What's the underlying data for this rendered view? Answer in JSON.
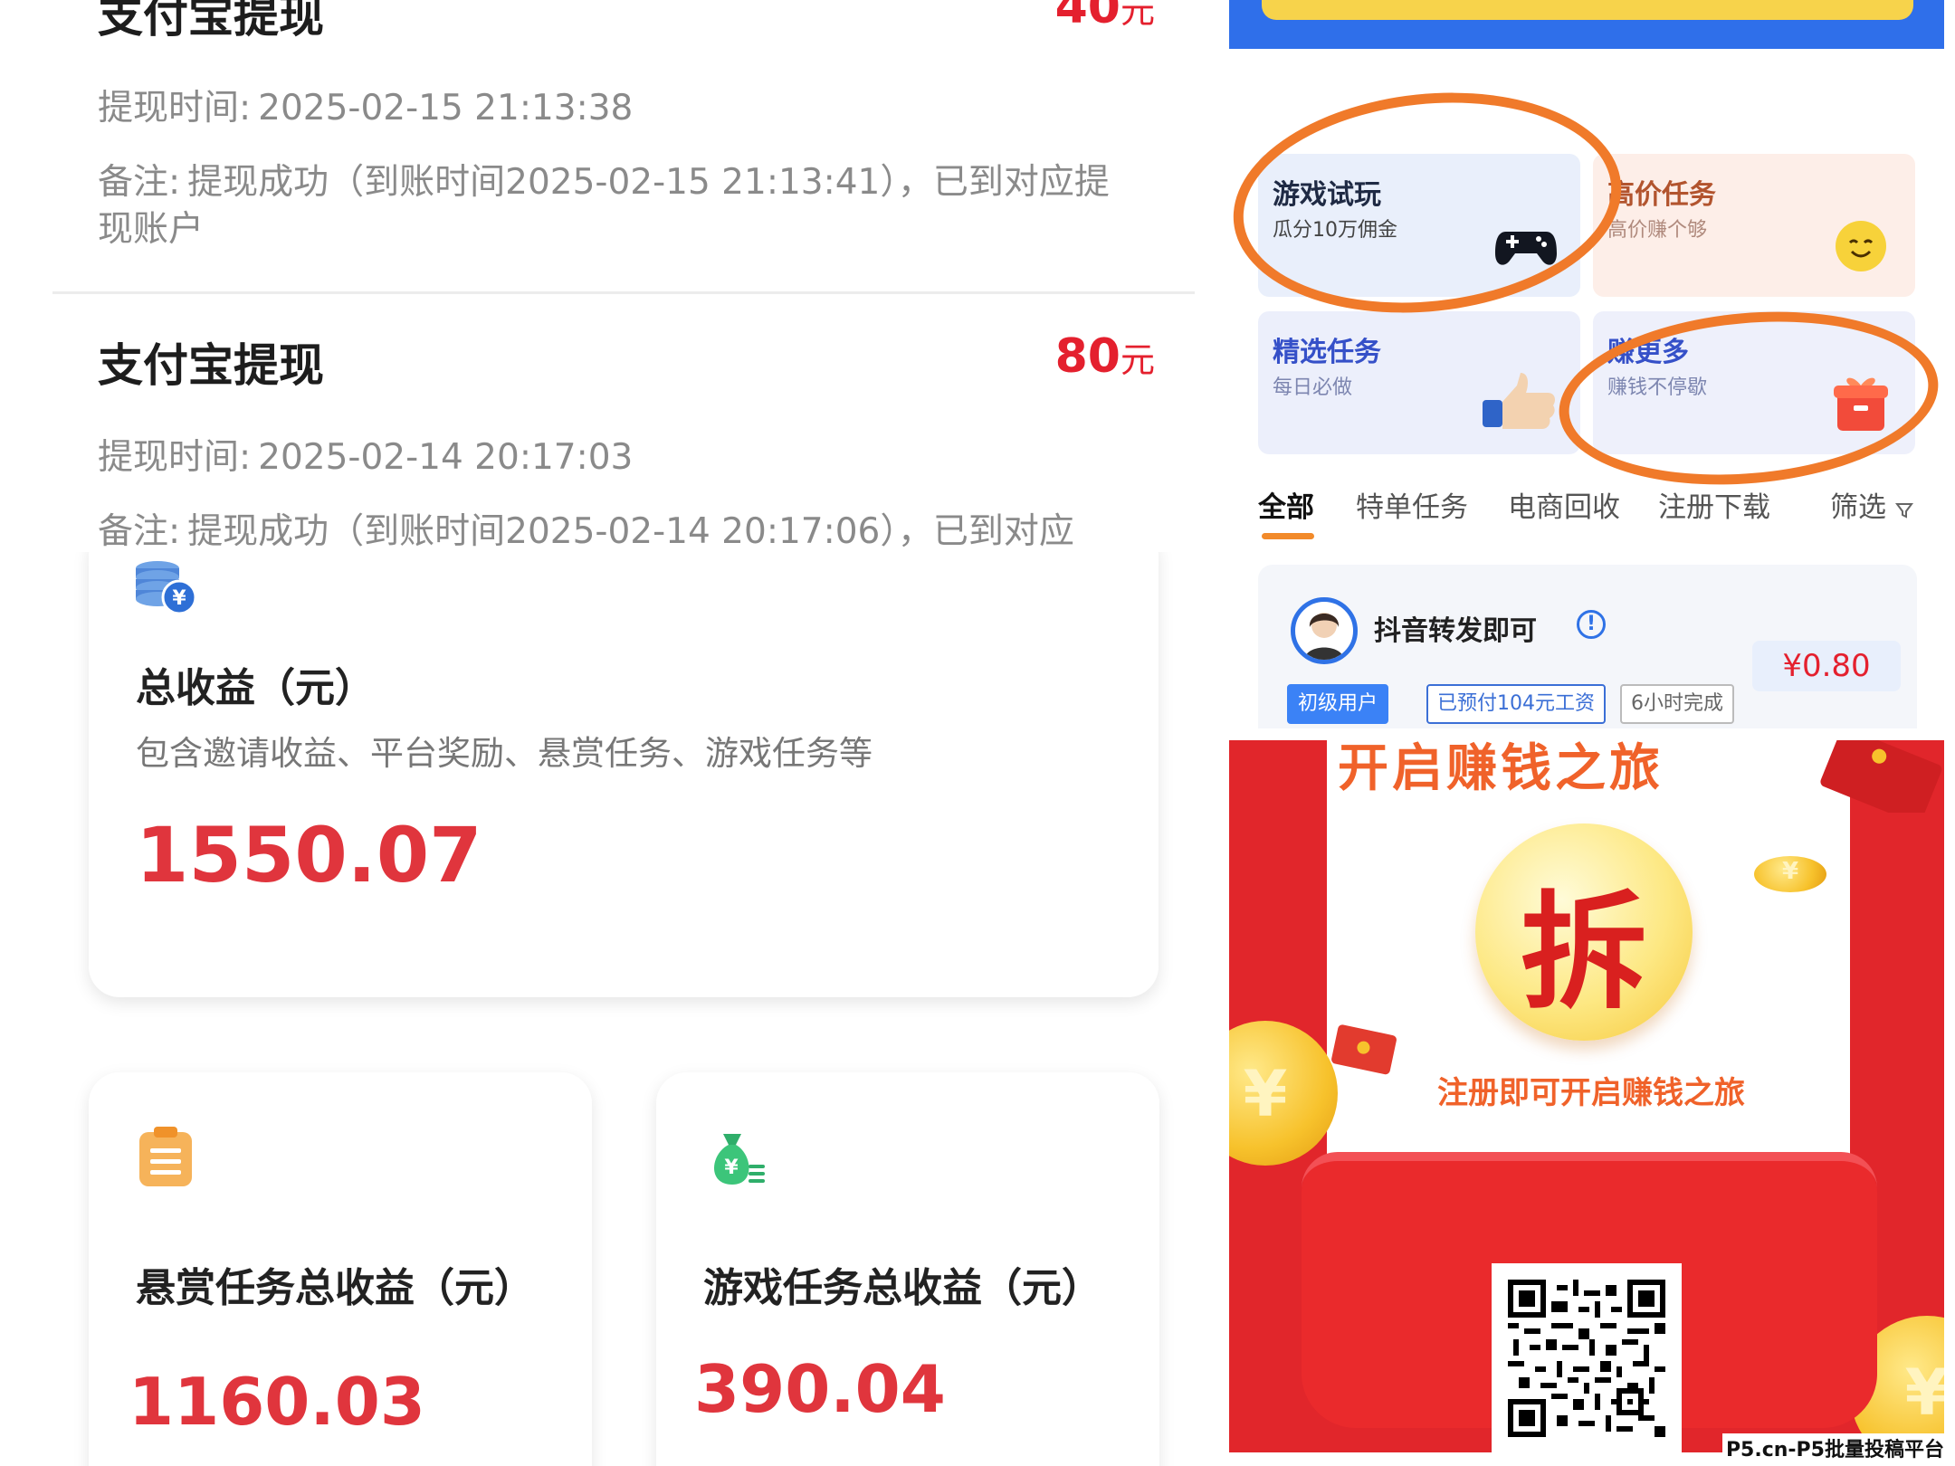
{
  "withdrawals": [
    {
      "title": "支付宝提现",
      "amount": "40",
      "unit": "元",
      "time_label": "提现时间:",
      "time": "2025-02-15 21:13:38",
      "note_label": "备注:",
      "note": "提现成功（到账时间2025-02-15 21:13:41），已到对应提现账户"
    },
    {
      "title": "支付宝提现",
      "amount": "80",
      "unit": "元",
      "time_label": "提现时间:",
      "time": "2025-02-14 20:17:03",
      "note_label": "备注:",
      "note": "提现成功（到账时间2025-02-14 20:17:06），已到对应"
    }
  ],
  "earnings": {
    "total": {
      "icon": "coin-stack-icon",
      "title": "总收益（元）",
      "desc": "包含邀请收益、平台奖励、悬赏任务、游戏任务等",
      "value": "1550.07"
    },
    "bounty": {
      "icon": "clipboard-icon",
      "title": "悬赏任务总收益（元）",
      "value": "1160.03"
    },
    "game": {
      "icon": "money-bag-icon",
      "title": "游戏任务总收益（元）",
      "value": "390.04"
    }
  },
  "categories": [
    {
      "title": "游戏试玩",
      "sub": "瓜分10万佣金",
      "icon": "gamepad-icon",
      "color": "#1f2a44",
      "bg": "#e9effb"
    },
    {
      "title": "高价任务",
      "sub": "高价赚个够",
      "icon": "smiley-icon",
      "color": "#b2542e",
      "bg": "#fdeee8"
    },
    {
      "title": "精选任务",
      "sub": "每日必做",
      "icon": "thumbs-up-icon",
      "color": "#3550c8",
      "bg": "#eceffb"
    },
    {
      "title": "赚更多",
      "sub": "赚钱不停歇",
      "icon": "gift-icon",
      "color": "#3550c8",
      "bg": "#eef0fb"
    }
  ],
  "tabs": [
    "全部",
    "特单任务",
    "电商回收",
    "注册下载",
    "筛选"
  ],
  "task": {
    "title": "抖音转发即可",
    "price": "¥0.80",
    "tags": [
      "初级用户",
      "已预付104元工资",
      "6小时完成"
    ]
  },
  "promo": {
    "title": "开启赚钱之旅",
    "button": "拆",
    "subtitle": "注册即可开启赚钱之旅"
  },
  "watermark": "P5.cn-P5批量投稿平台",
  "colors": {
    "accent_red": "#e4202e",
    "value_red": "#e0353d",
    "envelope_red": "#e1262b",
    "annotation_orange": "#f07a2a"
  }
}
